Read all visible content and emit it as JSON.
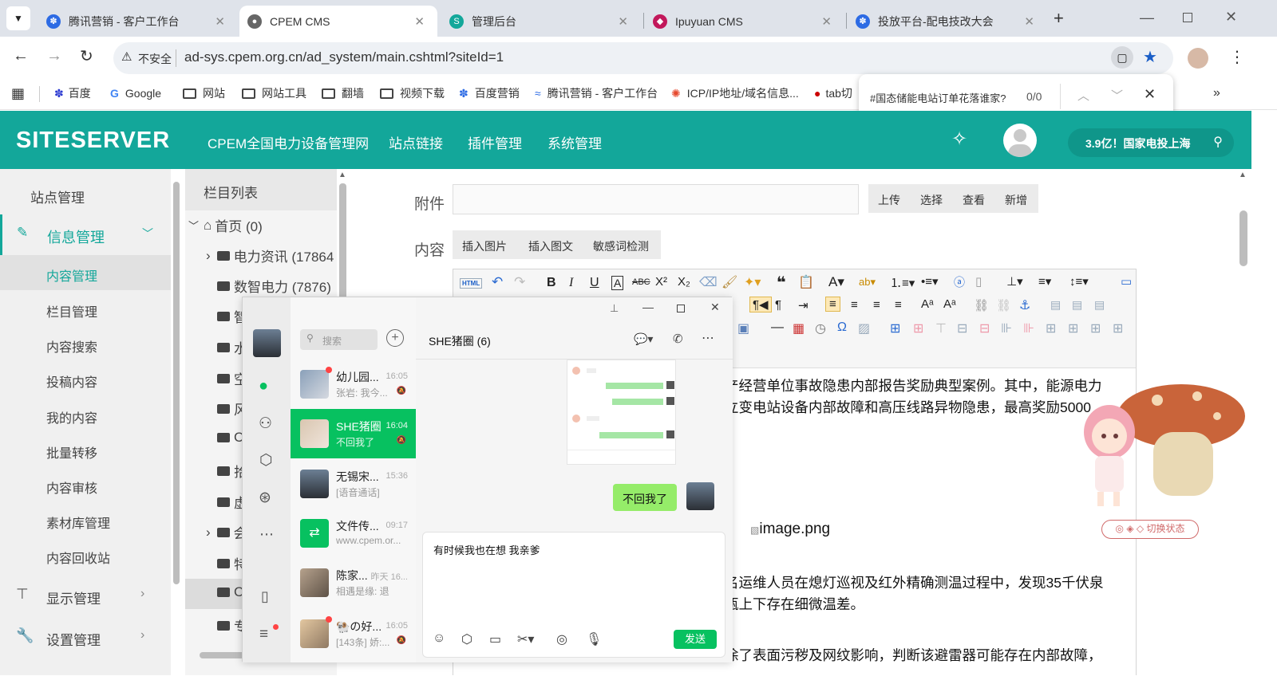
{
  "browser": {
    "tabs": [
      {
        "title": "腾讯营销 - 客户工作台",
        "active": false
      },
      {
        "title": "CPEM CMS",
        "active": true
      },
      {
        "title": "管理后台",
        "active": false
      },
      {
        "title": "Ipuyuan CMS",
        "active": false
      },
      {
        "title": "投放平台-配电技改大会",
        "active": false
      }
    ],
    "security_label": "不安全",
    "url": "ad-sys.cpem.org.cn/ad_system/main.cshtml?siteId=1",
    "bookmarks": [
      "百度",
      "Google",
      "网站",
      "网站工具",
      "翻墙",
      "视频下载",
      "百度营销",
      "腾讯营销 - 客户工作台",
      "ICP/IP地址/域名信息...",
      "tab切"
    ],
    "find_bar": {
      "query": "#国态储能电站订单花落谁家?",
      "count": "0/0"
    }
  },
  "site": {
    "logo": "SITESERVER",
    "nav": [
      "CPEM全国电力设备管理网",
      "站点链接",
      "插件管理",
      "系统管理"
    ],
    "search_text": "3.9亿！国家电投上海"
  },
  "sidebar": {
    "top_item": "站点管理",
    "section": "信息管理",
    "items": [
      "内容管理",
      "栏目管理",
      "内容搜索",
      "投稿内容",
      "我的内容",
      "批量转移",
      "内容审核",
      "素材库管理",
      "内容回收站"
    ],
    "bottom": [
      "显示管理",
      "设置管理"
    ]
  },
  "tree": {
    "header": "栏目列表",
    "nodes": [
      "首页 (0)",
      "电力资讯 (17864",
      "数智电力 (7876)",
      "智",
      "水",
      "空",
      "风",
      "C",
      "拾",
      "虚",
      "会",
      "特",
      "C",
      "专"
    ]
  },
  "editor": {
    "attach_label": "附件",
    "attach_buttons": [
      "上传",
      "选择",
      "查看",
      "新增"
    ],
    "content_label": "内容",
    "content_buttons": [
      "插入图片",
      "插入图文",
      "敏感词检测"
    ],
    "html_button": "HTML",
    "body_lines": [
      "产经营单位事故隐患内部报告奖励典型案例。其中，能源电力",
      "立变电站设备内部故障和高压线路异物隐患，最高奖励5000",
      "名运维人员在熄灯巡视及红外精确测温过程中，发现35千伏泉",
      "瓶上下存在细微温差。",
      "涂了表面污秽及网纹影响，判断该避雷器可能存在内部故障，"
    ],
    "image_alt": "image.png"
  },
  "wechat": {
    "search_placeholder": "搜索",
    "chat_title": "SHE猪圈 (6)",
    "conversations": [
      {
        "name": "幼儿园...",
        "time": "16:05",
        "msg": "张岩: 我今..."
      },
      {
        "name": "SHE猪圈",
        "time": "16:04",
        "msg": "不回我了"
      },
      {
        "name": "无锡宋...",
        "time": "15:36",
        "msg": "[语音通话]"
      },
      {
        "name": "文件传...",
        "time": "09:17",
        "msg": "www.cpem.or..."
      },
      {
        "name": "陈家...",
        "time": "昨天 16...",
        "msg": "相遇是缘: 退"
      },
      {
        "name": "🐏の好...",
        "time": "16:05",
        "msg": "[143条] 娇:..."
      }
    ],
    "last_message": "不回我了",
    "input_text": "有时候我也在想 我亲爹",
    "send_label": "发送"
  },
  "mascot": {
    "switch_label": "切换状态"
  }
}
